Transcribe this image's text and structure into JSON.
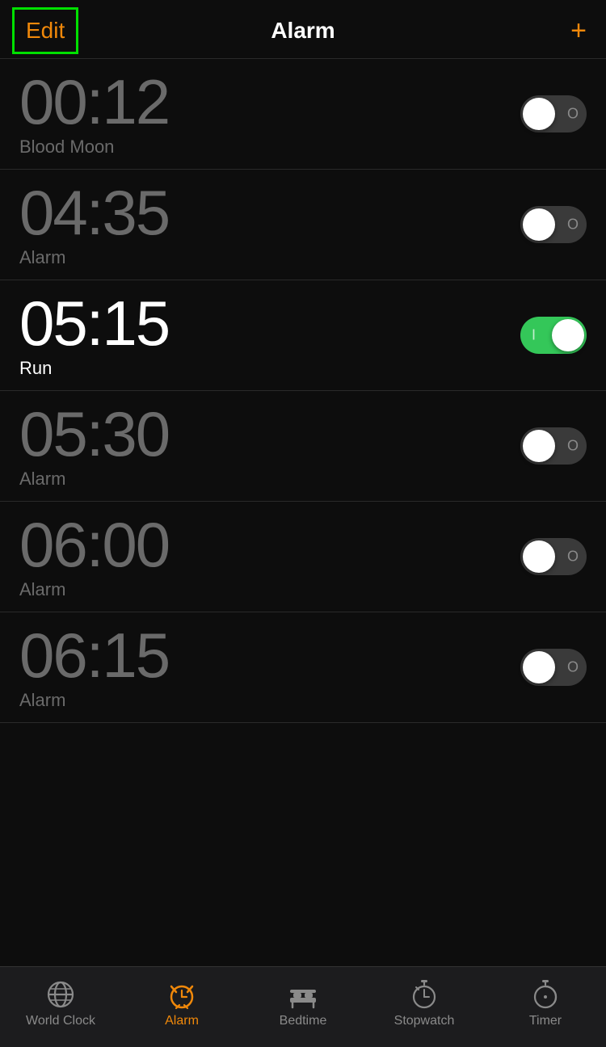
{
  "header": {
    "edit_label": "Edit",
    "title": "Alarm",
    "add_label": "+"
  },
  "alarms": [
    {
      "id": 1,
      "time": "00:12",
      "label": "Blood Moon",
      "enabled": false
    },
    {
      "id": 2,
      "time": "04:35",
      "label": "Alarm",
      "enabled": false
    },
    {
      "id": 3,
      "time": "05:15",
      "label": "Run",
      "enabled": true
    },
    {
      "id": 4,
      "time": "05:30",
      "label": "Alarm",
      "enabled": false
    },
    {
      "id": 5,
      "time": "06:00",
      "label": "Alarm",
      "enabled": false
    },
    {
      "id": 6,
      "time": "06:15",
      "label": "Alarm",
      "enabled": false
    }
  ],
  "tabs": [
    {
      "id": "world-clock",
      "label": "World Clock",
      "active": false
    },
    {
      "id": "alarm",
      "label": "Alarm",
      "active": true
    },
    {
      "id": "bedtime",
      "label": "Bedtime",
      "active": false
    },
    {
      "id": "stopwatch",
      "label": "Stopwatch",
      "active": false
    },
    {
      "id": "timer",
      "label": "Timer",
      "active": false
    }
  ]
}
